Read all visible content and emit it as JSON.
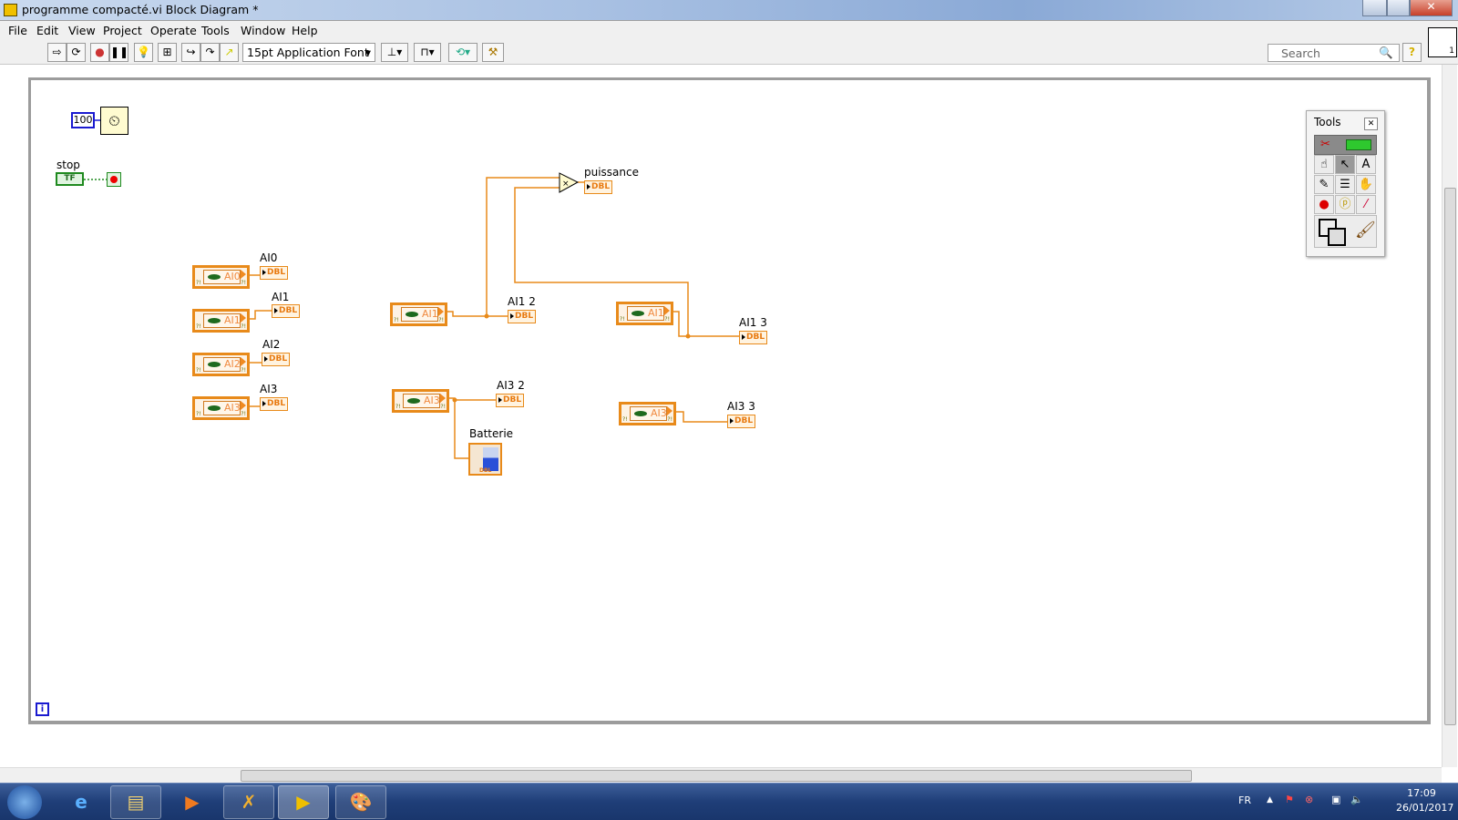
{
  "window": {
    "title": "programme compacté.vi Block Diagram *"
  },
  "menu": [
    "File",
    "Edit",
    "View",
    "Project",
    "Operate",
    "Tools",
    "Window",
    "Help"
  ],
  "toolbar": {
    "font": "15pt Application Font",
    "search_placeholder": "Search"
  },
  "diagram": {
    "wait_constant": "100",
    "stop_label": "stop",
    "bool_type": "TF",
    "dbl": "DBL",
    "daq_left": [
      "AI0",
      "AI1",
      "AI2",
      "AI3"
    ],
    "indicators_left": [
      "AI0",
      "AI1",
      "AI2",
      "AI3"
    ],
    "daq_mid_1": "AI1",
    "ind_mid_1": "AI1 2",
    "puissance": "puissance",
    "multiply": "×",
    "daq_right_1": "AI1",
    "ind_right_1": "AI1 3",
    "daq_mid_3": "AI3",
    "ind_mid_3": "AI3 2",
    "batterie": "Batterie",
    "daq_right_3": "AI3",
    "ind_right_3": "AI3 3",
    "info": "i"
  },
  "tools": {
    "title": "Tools"
  },
  "taskbar": {
    "lang": "FR",
    "time": "17:09",
    "date": "26/01/2017"
  },
  "colors": {
    "wire": "#e88a1a",
    "bool": "#1f8a1f",
    "constant": "#1a1ad0"
  }
}
